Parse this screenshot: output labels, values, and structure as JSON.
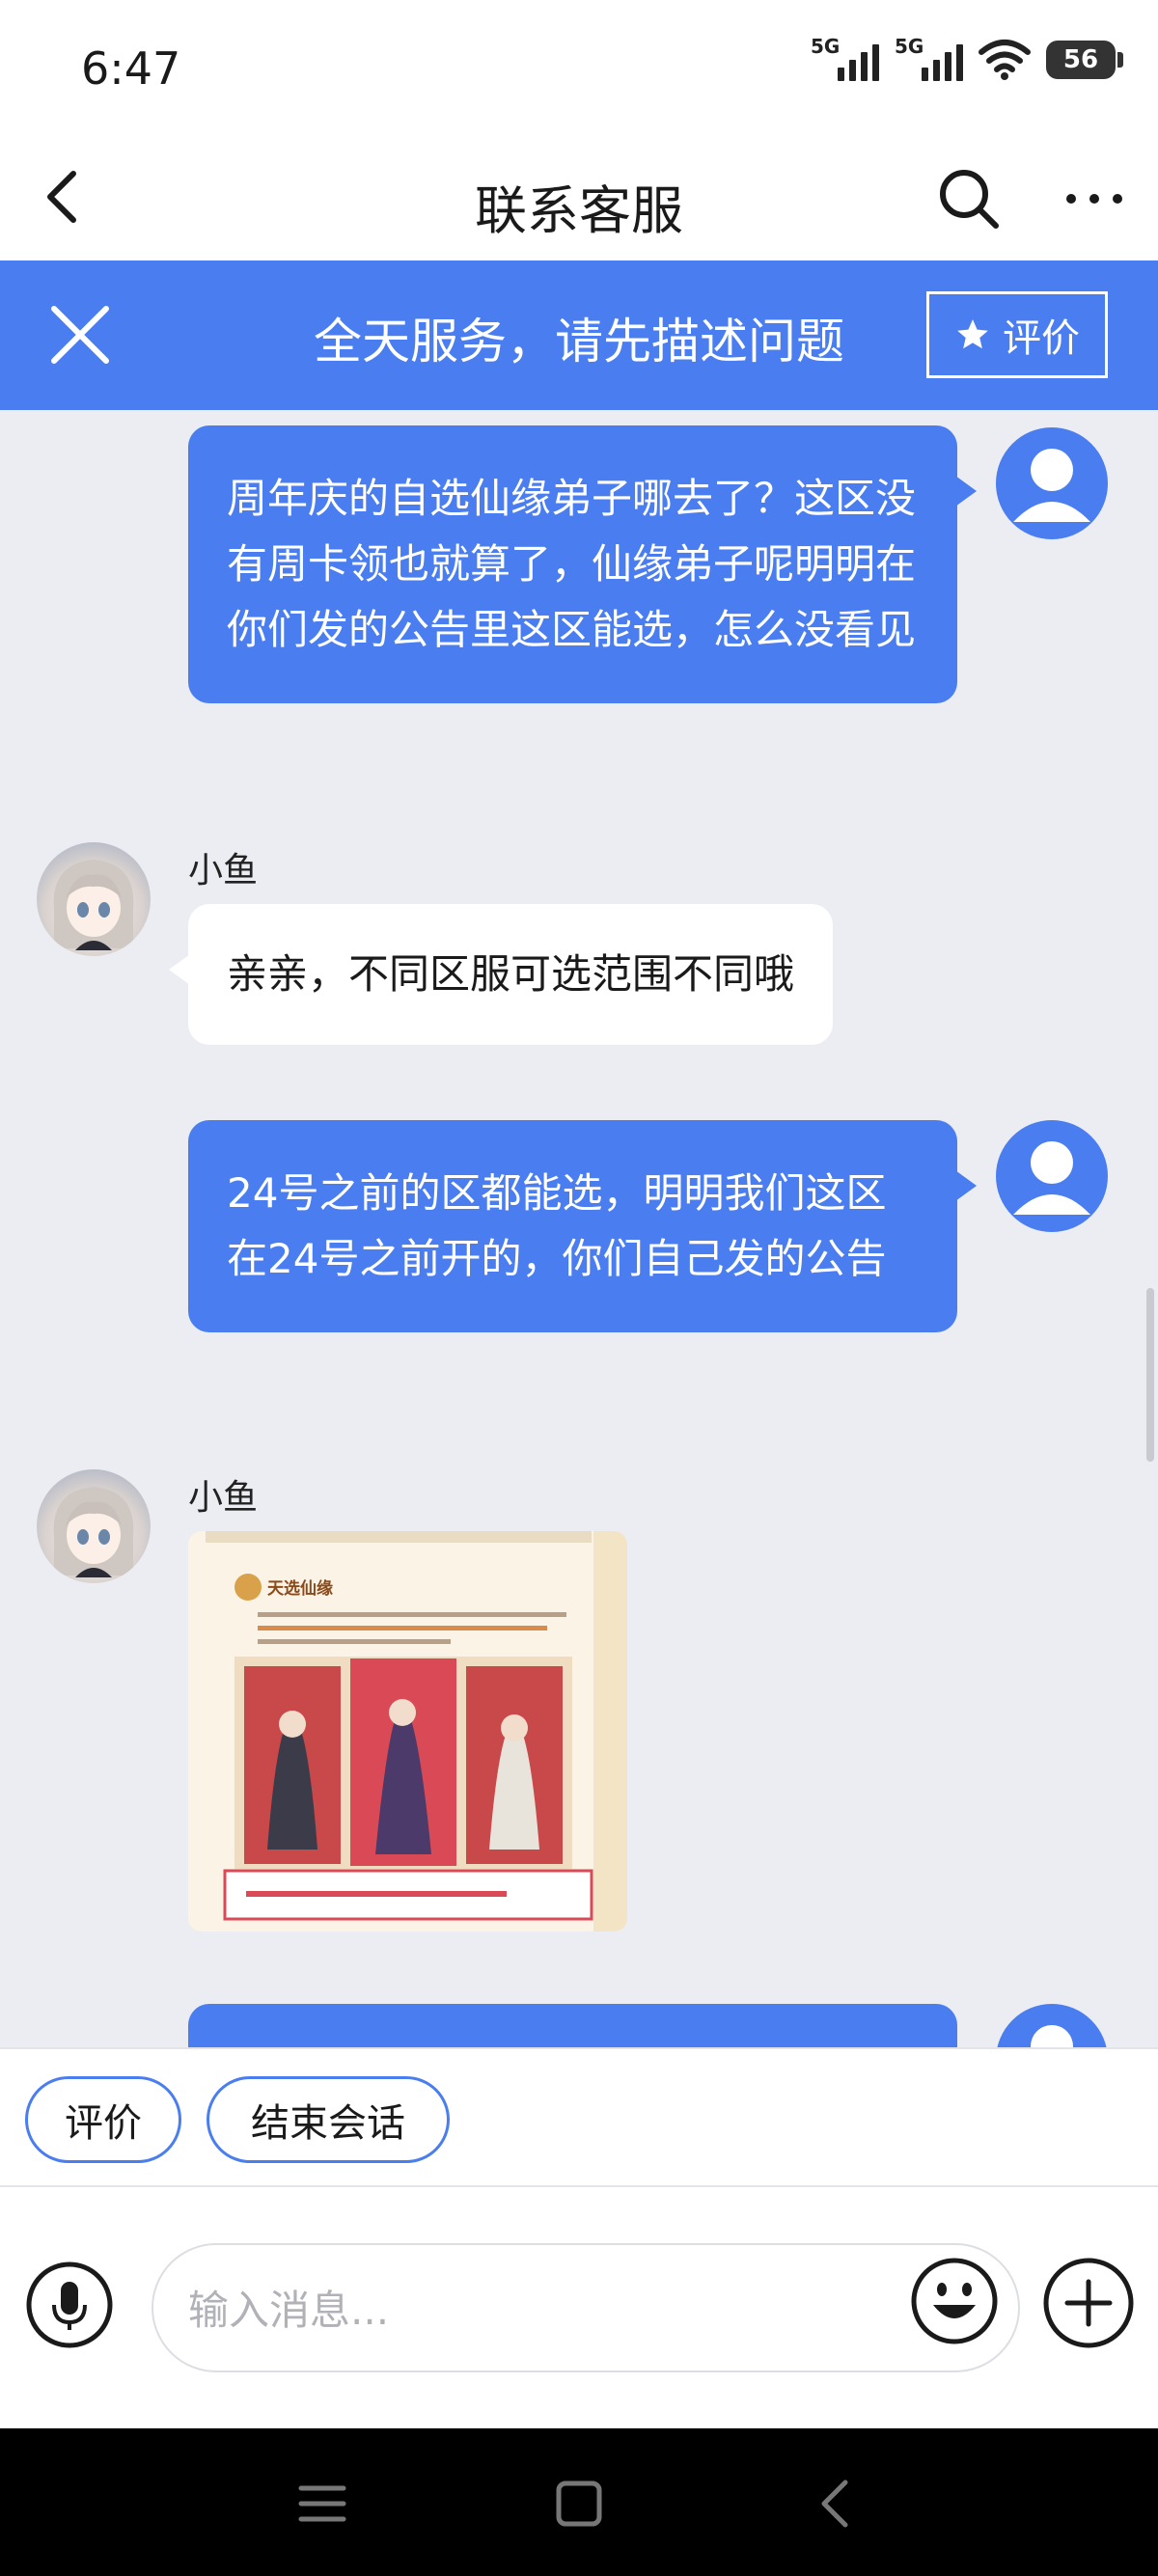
{
  "status_bar": {
    "time": "6:47",
    "network_1": "5G",
    "network_2": "5G",
    "battery": "56"
  },
  "header": {
    "title": "联系客服",
    "icons": [
      "back-icon",
      "search-icon",
      "more-icon"
    ]
  },
  "banner": {
    "text": "全天服务，请先描述问题",
    "rate_label": "评价",
    "background": "#4a7ef0"
  },
  "messages": [
    {
      "from": "user",
      "text": "周年庆的自选仙缘弟子哪去了？这区没有周卡领也就算了，仙缘弟子呢明明在你们发的公告里这区能选，怎么没看见"
    },
    {
      "from": "agent",
      "name": "小鱼",
      "text": "亲亲，不同区服可选范围不同哦"
    },
    {
      "from": "user",
      "text": "24号之前的区都能选，明明我们这区在24号之前开的，你们自己发的公告"
    },
    {
      "from": "agent",
      "name": "小鱼",
      "image": {
        "title": "天选仙缘"
      }
    }
  ],
  "quick_actions": [
    "评价",
    "结束会话"
  ],
  "input": {
    "placeholder": "输入消息...",
    "value": ""
  },
  "colors": {
    "accent": "#4a7ef0",
    "chat_background": "#ebedf2"
  }
}
